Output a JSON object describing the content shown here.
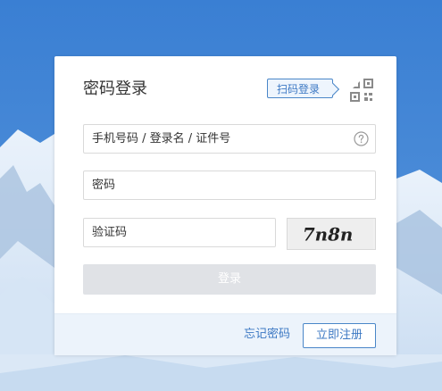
{
  "colors": {
    "sky": "#3f82d4",
    "accent": "#3c78c3",
    "button_disabled": "#e0e2e6",
    "footer_bg": "#ecf3fb"
  },
  "login": {
    "title": "密码登录",
    "qr_tip": "扫码登录",
    "qr_icon": "qr-code-icon",
    "username_placeholder": "手机号码 / 登录名 / 证件号",
    "help_icon": "question-circle-icon",
    "password_placeholder": "密码",
    "captcha_placeholder": "验证码",
    "captcha_text": "7n8n",
    "submit_label": "登录"
  },
  "footer": {
    "forgot_label": "忘记密码",
    "register_label": "立即注册"
  }
}
